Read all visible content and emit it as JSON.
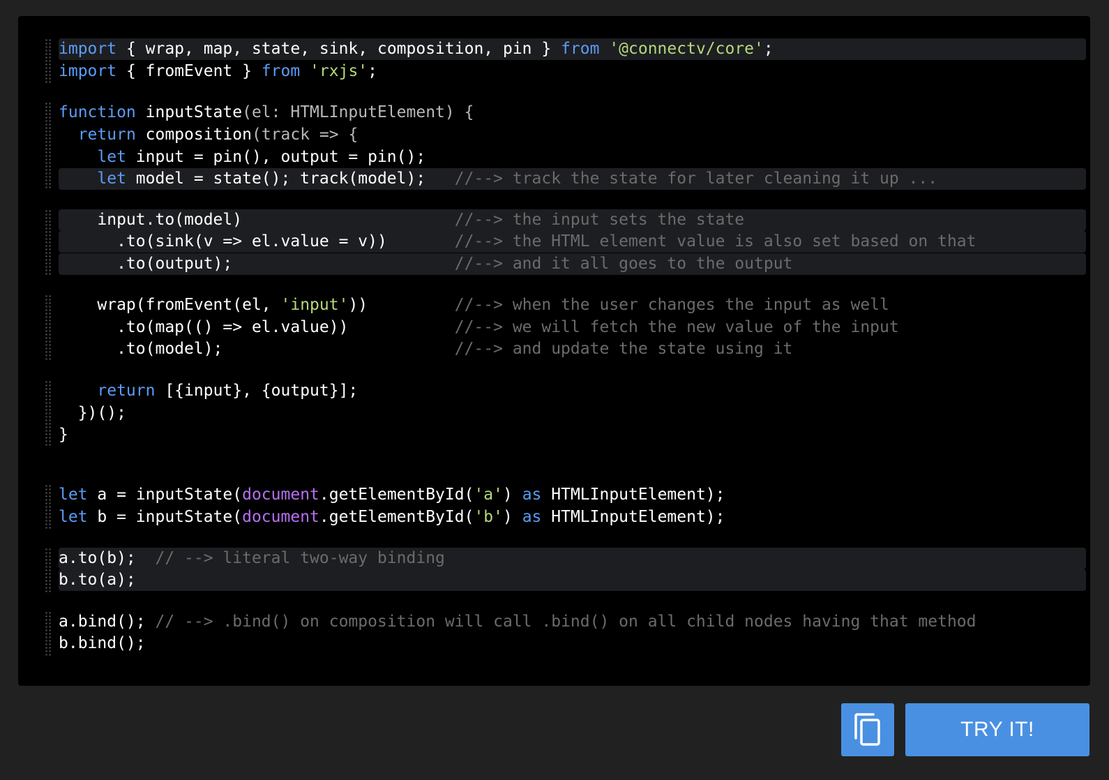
{
  "code": {
    "line1": {
      "kw1": "import",
      "t1": " { wrap, map, state, sink, composition, pin } ",
      "kw2": "from",
      "s1": " '@connectv/core'",
      "t2": ";"
    },
    "line2": {
      "kw1": "import",
      "t1": " { fromEvent } ",
      "kw2": "from",
      "s1": " 'rxjs'",
      "t2": ";"
    },
    "line3": {
      "kw1": "function",
      "t1": " inputState",
      "d1": "(el: HTMLInputElement) {"
    },
    "line4": {
      "pre": "  ",
      "kw1": "return",
      "t1": " composition",
      "d1": "(track => {"
    },
    "line5": {
      "pre": "    ",
      "kw1": "let",
      "t1": " input = pin(), output = pin();"
    },
    "line6": {
      "pre": "    ",
      "kw1": "let",
      "t1": " model = state(); track(model);   ",
      "c1": "//--> track the state for later cleaning it up ..."
    },
    "line7": {
      "t1": "    input.to(model)                      ",
      "c1": "//--> the input sets the state"
    },
    "line8": {
      "t1": "      .to(sink(v => el.value = v))       ",
      "c1": "//--> the HTML element value is also set based on that"
    },
    "line9": {
      "t1": "      .to(output);                       ",
      "c1": "//--> and it all goes to the output"
    },
    "line10": {
      "t1": "    wrap(fromEvent(el, ",
      "s1": "'input'",
      "t2": "))         ",
      "c1": "//--> when the user changes the input as well"
    },
    "line11": {
      "t1": "      .to(map(() => el.value))           ",
      "c1": "//--> we will fetch the new value of the input"
    },
    "line12": {
      "t1": "      .to(model);                        ",
      "c1": "//--> and update the state using it"
    },
    "line13": {
      "pre": "    ",
      "kw1": "return",
      "t1": " [{input}, {output}];"
    },
    "line14": {
      "t1": "  })();"
    },
    "line15": {
      "t1": "}"
    },
    "line16": {
      "kw1": "let",
      "t1": " a = inputState(",
      "g1": "document",
      "t2": ".getElementById(",
      "s1": "'a'",
      "t3": ") ",
      "kw2": "as",
      "t4": " HTMLInputElement);"
    },
    "line17": {
      "kw1": "let",
      "t1": " b = inputState(",
      "g1": "document",
      "t2": ".getElementById(",
      "s1": "'b'",
      "t3": ") ",
      "kw2": "as",
      "t4": " HTMLInputElement);"
    },
    "line18": {
      "t1": "a.to(b);  ",
      "c1": "// --> literal two-way binding"
    },
    "line19": {
      "t1": "b.to(a);"
    },
    "line20": {
      "t1": "a.bind(); ",
      "c1": "// --> .bind() on composition will call .bind() on all child nodes having that method"
    },
    "line21": {
      "t1": "b.bind();"
    }
  },
  "actions": {
    "copy_icon": "copy-icon",
    "try_label": "TRY IT!"
  },
  "colors": {
    "accent": "#4a90e2",
    "keyword": "#5b9cf5",
    "string": "#b5d97a",
    "comment": "#6b6b6b",
    "global": "#b670f0"
  }
}
